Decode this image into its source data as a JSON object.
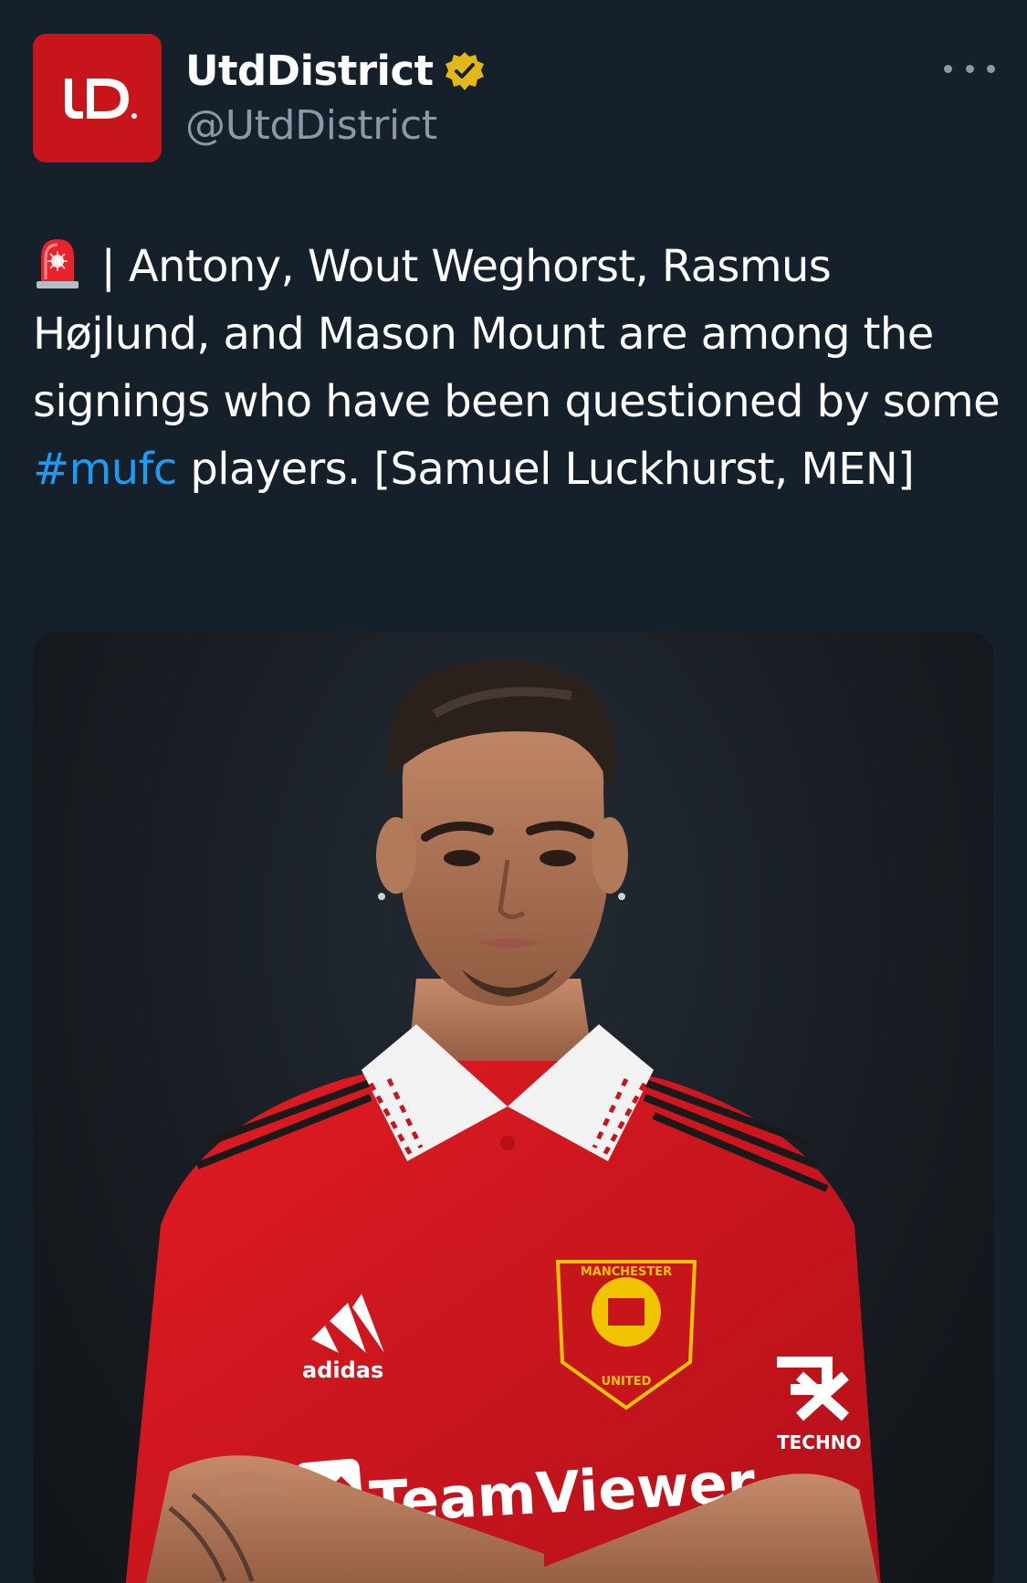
{
  "author": {
    "display_name": "UtdDistrict",
    "handle": "@UtdDistrict",
    "verified": true,
    "avatar_color": "#c8141b",
    "avatar_letters": "UD"
  },
  "menu": {
    "icon": "more-horizontal-icon"
  },
  "tweet": {
    "emoji": "siren-icon",
    "text_segments": {
      "lead": " | Antony, Wout Weghorst, Rasmus Højlund, and Mason Mount are among the signings who have been questioned by some ",
      "hashtag": "#mufc",
      "tail": " players. [Samuel Luckhurst, MEN]"
    }
  },
  "media": {
    "type": "photo",
    "shirt_color": "#d9141e",
    "sponsor_text": "TeamViewer",
    "brand_text": "adidas",
    "crest_top_text": "MANCHESTER",
    "crest_bottom_text": "UNITED",
    "sleeve_text": "TECHNO"
  },
  "colors": {
    "background": "#15202b",
    "text": "#ffffff",
    "secondary_text": "#8b98a5",
    "link": "#1d9bf0",
    "verified_badge": "#e2b719"
  }
}
